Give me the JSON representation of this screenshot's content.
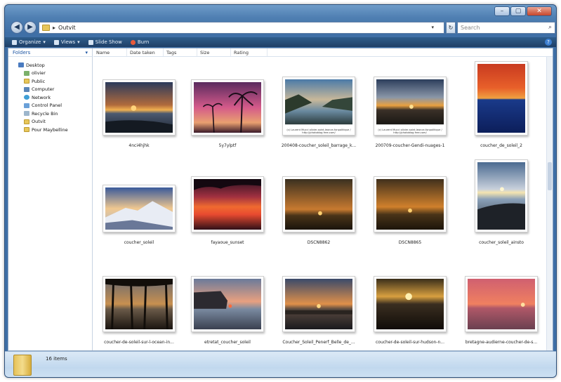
{
  "window": {
    "address_path": "Outvit",
    "search_placeholder": "Search",
    "caption_buttons": [
      "–",
      "▢",
      "✕"
    ]
  },
  "toolbar": {
    "organize": "Organize",
    "views": "Views",
    "slideshow": "Slide Show",
    "burn": "Burn"
  },
  "nav": {
    "header": "Folders",
    "items": [
      {
        "label": "Desktop",
        "icon": "desktop-icon"
      },
      {
        "label": "olivier",
        "icon": "user-icon"
      },
      {
        "label": "Public",
        "icon": "folder-icon"
      },
      {
        "label": "Computer",
        "icon": "computer-icon"
      },
      {
        "label": "Network",
        "icon": "network-icon"
      },
      {
        "label": "Control Panel",
        "icon": "control-panel-icon"
      },
      {
        "label": "Recycle Bin",
        "icon": "recycle-bin-icon"
      },
      {
        "label": "Outvit",
        "icon": "folder-icon"
      },
      {
        "label": "Pour Maybelline",
        "icon": "folder-icon"
      }
    ]
  },
  "columns": [
    "Name",
    "Date taken",
    "Tags",
    "Size",
    "Rating"
  ],
  "files": [
    {
      "name": "4nci4hjhk"
    },
    {
      "name": "5y7ylptf"
    },
    {
      "name": "200408-coucher_soleil_barrage_k...",
      "web_text": "(c) Laurent Mucci olivier-saint-leonce-fonpolitique / http://photoblog.free.com/"
    },
    {
      "name": "200709-coucher-Gendi-nuages-1",
      "web_text": "(c) Laurent Mucci olivier-saint-leonce-fonpolitique / http://photoblog.free.com/"
    },
    {
      "name": "coucher_de_soleil_2"
    },
    {
      "name": "coucher_soleil"
    },
    {
      "name": "fayaoue_sunset"
    },
    {
      "name": "DSCN8862"
    },
    {
      "name": "DSCN8865"
    },
    {
      "name": "coucher_soleil_ainsto"
    },
    {
      "name": "coucher-de-soleil-sur-l-ocean-in..."
    },
    {
      "name": "etretat_coucher_soleil"
    },
    {
      "name": "Coucher_Soleil_Penerf_Belle_de_..."
    },
    {
      "name": "coucher-de-soleil-sur-hudson-n..."
    },
    {
      "name": "bretagne-audierne-coucher-de-s..."
    }
  ],
  "status": {
    "item_count": "16 items"
  }
}
